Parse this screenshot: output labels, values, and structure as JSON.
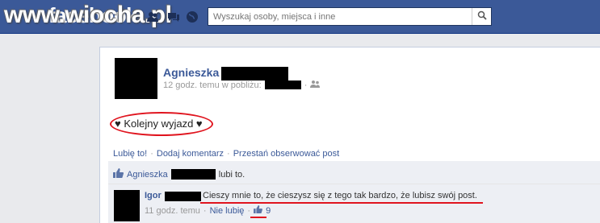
{
  "topbar": {
    "logo": "facebook",
    "watermark": "www.wiocha.pl",
    "search_placeholder": "Wyszukaj osoby, miejsca i inne"
  },
  "post": {
    "author": "Agnieszka",
    "meta_time": "12 godz. temu w pobliżu:",
    "meta_dot": "·",
    "text": "♥ Kolejny wyjazd ♥",
    "actions": {
      "like": "Lubię to!",
      "comment": "Dodaj komentarz",
      "unfollow": "Przestań obserwować post",
      "sep": "·"
    }
  },
  "likes": {
    "name": "Agnieszka",
    "suffix": "lubi to."
  },
  "comment": {
    "author": "Igor",
    "text": "Cieszy mnie to, że cieszysz się z tego tak bardzo, że lubisz swój post.",
    "time": "11 godz. temu",
    "sep": "·",
    "unlike": "Nie lubię",
    "like_count": "9"
  },
  "colors": {
    "fb_blue": "#3b5998",
    "highlight_red": "#e0141e"
  }
}
